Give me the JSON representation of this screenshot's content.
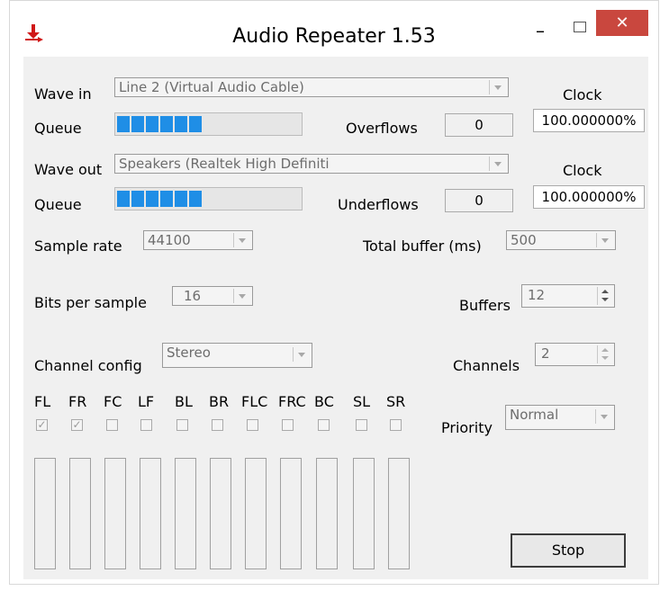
{
  "window": {
    "title": "Audio Repeater 1.53",
    "minimize": "–",
    "close": "✕"
  },
  "wave_in": {
    "label": "Wave in",
    "device": "Line 2 (Virtual Audio Cable)",
    "clock_label": "Clock",
    "clock_value": "100.000000%",
    "queue_label": "Queue",
    "queue_fill": 0.5,
    "overflows_label": "Overflows",
    "overflows_value": "0"
  },
  "wave_out": {
    "label": "Wave out",
    "device": "Speakers (Realtek High Definiti",
    "clock_label": "Clock",
    "clock_value": "100.000000%",
    "queue_label": "Queue",
    "queue_fill": 0.5,
    "underflows_label": "Underflows",
    "underflows_value": "0"
  },
  "settings": {
    "sample_rate_label": "Sample rate",
    "sample_rate_value": "44100",
    "total_buffer_label": "Total buffer (ms)",
    "total_buffer_value": "500",
    "bits_label": "Bits per sample",
    "bits_value": "16",
    "buffers_label": "Buffers",
    "buffers_value": "12",
    "channel_config_label": "Channel config",
    "channel_config_value": "Stereo",
    "channels_label": "Channels",
    "channels_value": "2",
    "priority_label": "Priority",
    "priority_value": "Normal"
  },
  "channels": [
    {
      "name": "FL",
      "checked": true
    },
    {
      "name": "FR",
      "checked": true
    },
    {
      "name": "FC",
      "checked": false
    },
    {
      "name": "LF",
      "checked": false
    },
    {
      "name": "BL",
      "checked": false
    },
    {
      "name": "BR",
      "checked": false
    },
    {
      "name": "FLC",
      "checked": false
    },
    {
      "name": "FRC",
      "checked": false
    },
    {
      "name": "BC",
      "checked": false
    },
    {
      "name": "SL",
      "checked": false
    },
    {
      "name": "SR",
      "checked": false
    }
  ],
  "actions": {
    "stop_label": "Stop"
  },
  "icons": {
    "app": "app-arrow-icon",
    "minimize": "minimize-icon",
    "maximize": "maximize-icon",
    "close": "close-icon"
  },
  "colors": {
    "progress": "#1f8ee6",
    "close_button": "#c9473e",
    "app_icon": "#d01818"
  }
}
